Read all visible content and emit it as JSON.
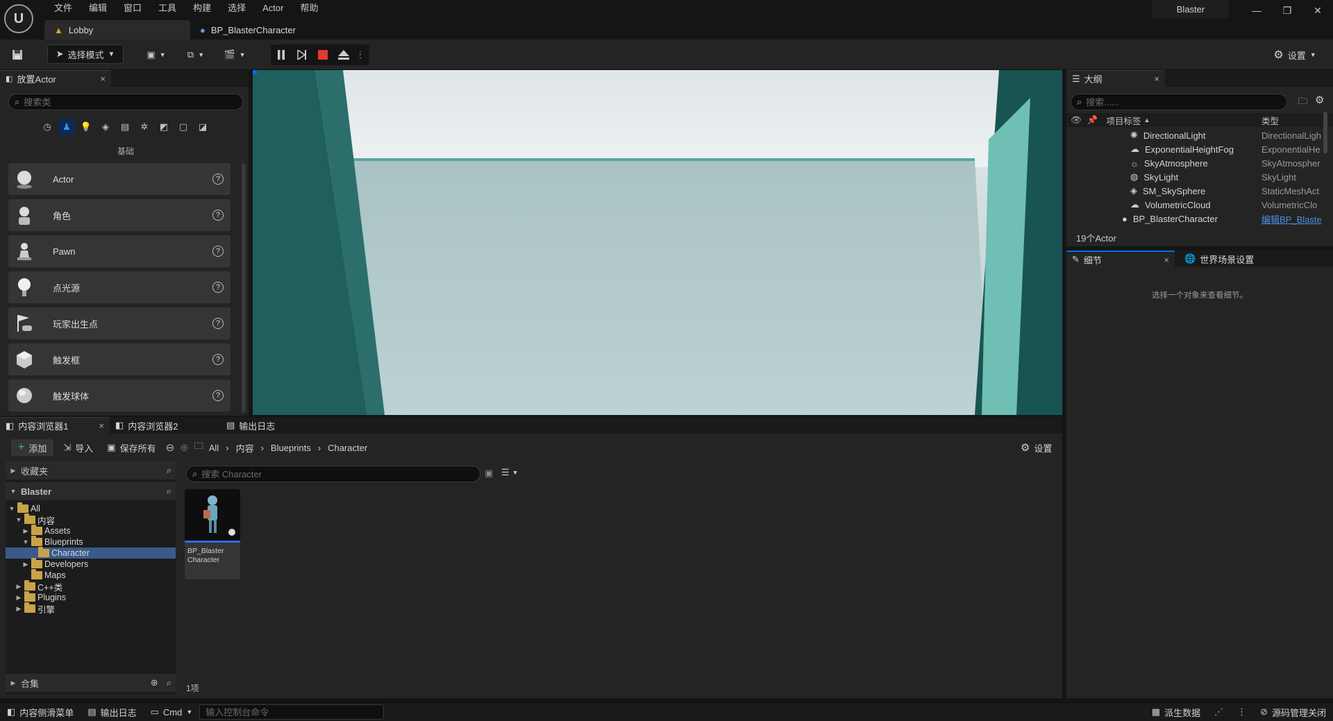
{
  "app": {
    "project_name": "Blaster",
    "menu": [
      "文件",
      "编辑",
      "窗口",
      "工具",
      "构建",
      "选择",
      "Actor",
      "帮助"
    ],
    "tabs": [
      {
        "label": "Lobby"
      },
      {
        "label": "BP_BlasterCharacter"
      }
    ]
  },
  "toolbar": {
    "mode_label": "选择模式",
    "settings_label": "设置"
  },
  "place_actors": {
    "tab_label": "放置Actor",
    "search_placeholder": "搜索类",
    "category_label": "基础",
    "items": [
      {
        "label": "Actor",
        "icon": "sphere-icon"
      },
      {
        "label": "角色",
        "icon": "character-icon"
      },
      {
        "label": "Pawn",
        "icon": "pawn-icon"
      },
      {
        "label": "点光源",
        "icon": "point-light-icon"
      },
      {
        "label": "玩家出生点",
        "icon": "player-start-icon"
      },
      {
        "label": "触发框",
        "icon": "trigger-box-icon"
      },
      {
        "label": "触发球体",
        "icon": "trigger-sphere-icon"
      }
    ]
  },
  "outliner": {
    "tab_label": "大纲",
    "search_placeholder": "搜索......",
    "col_label": "项目标签",
    "col_type": "类型",
    "rows": [
      {
        "label": "DirectionalLight",
        "type": "DirectionalLigh"
      },
      {
        "label": "ExponentialHeightFog",
        "type": "ExponentialHe"
      },
      {
        "label": "SkyAtmosphere",
        "type": "SkyAtmospher"
      },
      {
        "label": "SkyLight",
        "type": "SkyLight"
      },
      {
        "label": "SM_SkySphere",
        "type": "StaticMeshAct"
      },
      {
        "label": "VolumetricCloud",
        "type": "VolumetricClo"
      },
      {
        "label": "BP_BlasterCharacter",
        "type": "编辑BP_Blaste"
      }
    ],
    "count": "19个Actor"
  },
  "details": {
    "tab_label": "细节",
    "world_settings_label": "世界场景设置",
    "empty_message": "选择一个对象来查看细节。"
  },
  "content_browser": {
    "tabs": [
      "内容浏览器1",
      "内容浏览器2",
      "输出日志"
    ],
    "add_label": "添加",
    "import_label": "导入",
    "save_all_label": "保存所有",
    "breadcrumb": [
      "All",
      "内容",
      "Blueprints",
      "Character"
    ],
    "settings_label": "设置",
    "favorites_label": "收藏夹",
    "project_label": "Blaster",
    "collections_label": "合集",
    "search_placeholder": "搜索 Character",
    "tree": [
      {
        "label": "All"
      },
      {
        "label": "内容"
      },
      {
        "label": "Assets"
      },
      {
        "label": "Blueprints"
      },
      {
        "label": "Character"
      },
      {
        "label": "Developers"
      },
      {
        "label": "Maps"
      },
      {
        "label": "C++类"
      },
      {
        "label": "Plugins"
      },
      {
        "label": "引擎"
      }
    ],
    "asset": {
      "line1": "BP_Blaster",
      "line2": "Character"
    },
    "item_count": "1项"
  },
  "statusbar": {
    "content_drawer": "内容侧滑菜单",
    "output_log": "输出日志",
    "cmd": "Cmd",
    "console_placeholder": "输入控制台命令",
    "derived_data": "派生数据",
    "source_control": "源码管理关闭"
  },
  "colors": {
    "accent": "#0070e0",
    "play_stop": "#e03c31",
    "folder": "#c9a349"
  }
}
